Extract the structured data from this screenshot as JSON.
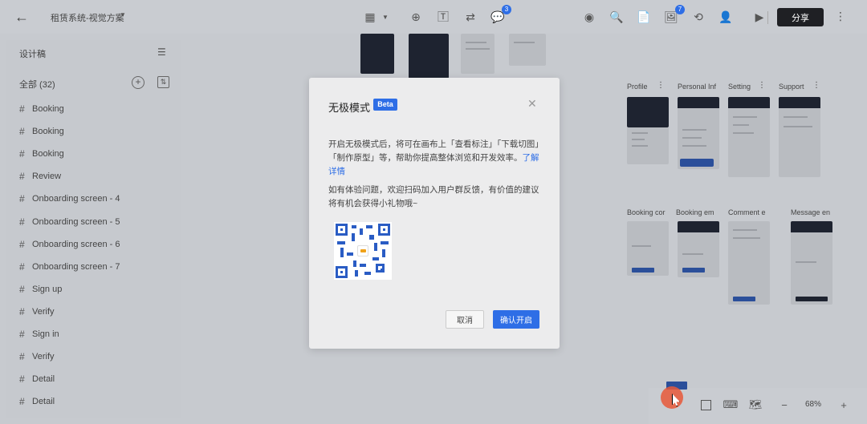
{
  "header": {
    "back_icon": "arrow-left-icon",
    "project_title": "租赁系统-视觉方案",
    "comment_badge": "3",
    "inspect_badge": "7",
    "share_label": "分享"
  },
  "sidebar": {
    "title": "设计稿",
    "all_label": "全部 (32)",
    "items": [
      "Booking",
      "Booking",
      "Booking",
      "Review",
      "Onboarding screen - 4",
      "Onboarding screen - 5",
      "Onboarding screen - 6",
      "Onboarding screen - 7",
      "Sign up",
      "Verify",
      "Sign in",
      "Verify",
      "Detail",
      "Detail"
    ]
  },
  "canvas": {
    "frames_row1": [
      "Profile",
      "Personal Inf",
      "Setting",
      "Support"
    ],
    "frames_row2": [
      "Booking cor",
      "Booking em",
      "Comment e",
      "Message en"
    ]
  },
  "dialog": {
    "title": "无极模式",
    "beta": "Beta",
    "paragraph1": "开启无极模式后，将可在画布上「查看标注」「下载切图」「制作原型」等，帮助你提高整体浏览和开发效率。",
    "link": "了解详情",
    "paragraph2": "如有体验问题，欢迎扫码加入用户群反馈，有价值的建议将有机会获得小礼物哦~",
    "cancel_label": "取消",
    "confirm_label": "确认开启"
  },
  "bottom_bar": {
    "zoom": "68%"
  },
  "colors": {
    "accent": "#2e6ee6",
    "share_button": "#1f2024"
  }
}
